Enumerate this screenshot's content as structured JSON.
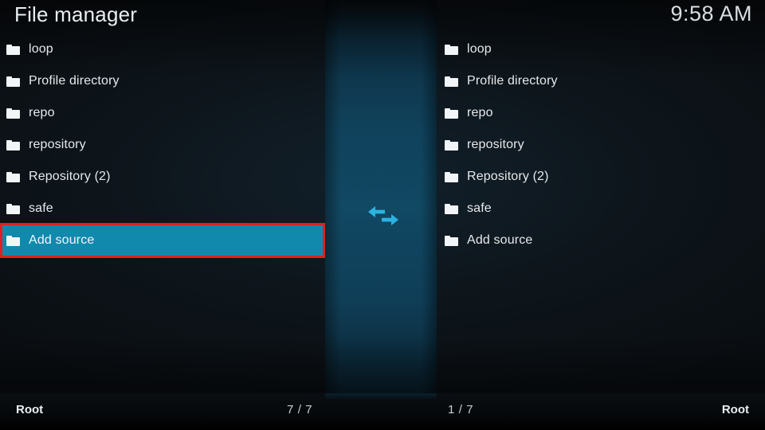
{
  "header": {
    "title": "File manager",
    "clock": "9:58 AM"
  },
  "icons": {
    "folder": "folder-icon",
    "swap": "swap-horizontal-arrows-icon"
  },
  "colors": {
    "highlight_fill": "#1189AD",
    "focus_border": "#E02020",
    "center_strip": "#114863",
    "background": "#0D1217",
    "text": "#E6EAED"
  },
  "left_panel": {
    "items": [
      {
        "label": "loop"
      },
      {
        "label": "Profile directory"
      },
      {
        "label": "repo"
      },
      {
        "label": "repository"
      },
      {
        "label": "Repository (2)"
      },
      {
        "label": "safe"
      },
      {
        "label": "Add source"
      }
    ],
    "selected_index": 6,
    "status": {
      "path": "Root",
      "count": "7 / 7"
    }
  },
  "right_panel": {
    "items": [
      {
        "label": "loop"
      },
      {
        "label": "Profile directory"
      },
      {
        "label": "repo"
      },
      {
        "label": "repository"
      },
      {
        "label": "Repository (2)"
      },
      {
        "label": "safe"
      },
      {
        "label": "Add source"
      }
    ],
    "selected_index": null,
    "status": {
      "path": "Root",
      "count": "1 / 7"
    }
  }
}
